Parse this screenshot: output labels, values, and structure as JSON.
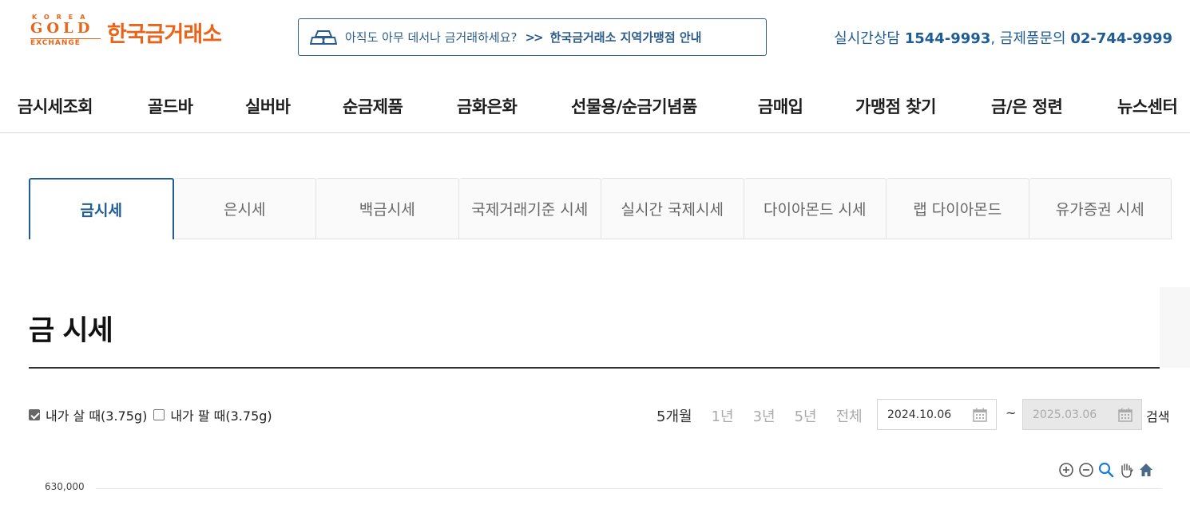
{
  "header": {
    "logo_korea": "KOREA",
    "logo_gold": "GOLD",
    "logo_exchange": "EXCHANGE",
    "logo_name": "한국금거래소",
    "banner_text": "아직도 아무 데서나 금거래하세요?",
    "banner_link": "한국금거래소 지역가맹점 안내",
    "contact_label1": "실시간상담 ",
    "contact_phone1": "1544-9993",
    "contact_label2": ", 금제품문의 ",
    "contact_phone2": "02-744-9999"
  },
  "nav": [
    "금시세조회",
    "골드바",
    "실버바",
    "순금제품",
    "금화은화",
    "선물용/순금기념품",
    "금매입",
    "가맹점 찾기",
    "금/은 정련",
    "뉴스센터"
  ],
  "tabs": [
    "금시세",
    "은시세",
    "백금시세",
    "국제거래기준 시세",
    "실시간 국제시세",
    "다이아몬드 시세",
    "랩 다이아몬드",
    "유가증권 시세"
  ],
  "page_title": "금 시세",
  "filters": {
    "buy_label": "내가 살 때(3.75g)",
    "sell_label": "내가 팔 때(3.75g)",
    "buy_checked": true,
    "sell_checked": false
  },
  "periods": [
    "5개월",
    "1년",
    "3년",
    "5년",
    "전체"
  ],
  "date_from": "2024.10.06",
  "date_to": "2025.03.06",
  "search_label": "검색",
  "chart_data": {
    "type": "line",
    "y_ticks": [
      "630,000"
    ]
  },
  "colors": {
    "brand_orange": "#e8641b",
    "accent_blue": "#1f5d94"
  }
}
